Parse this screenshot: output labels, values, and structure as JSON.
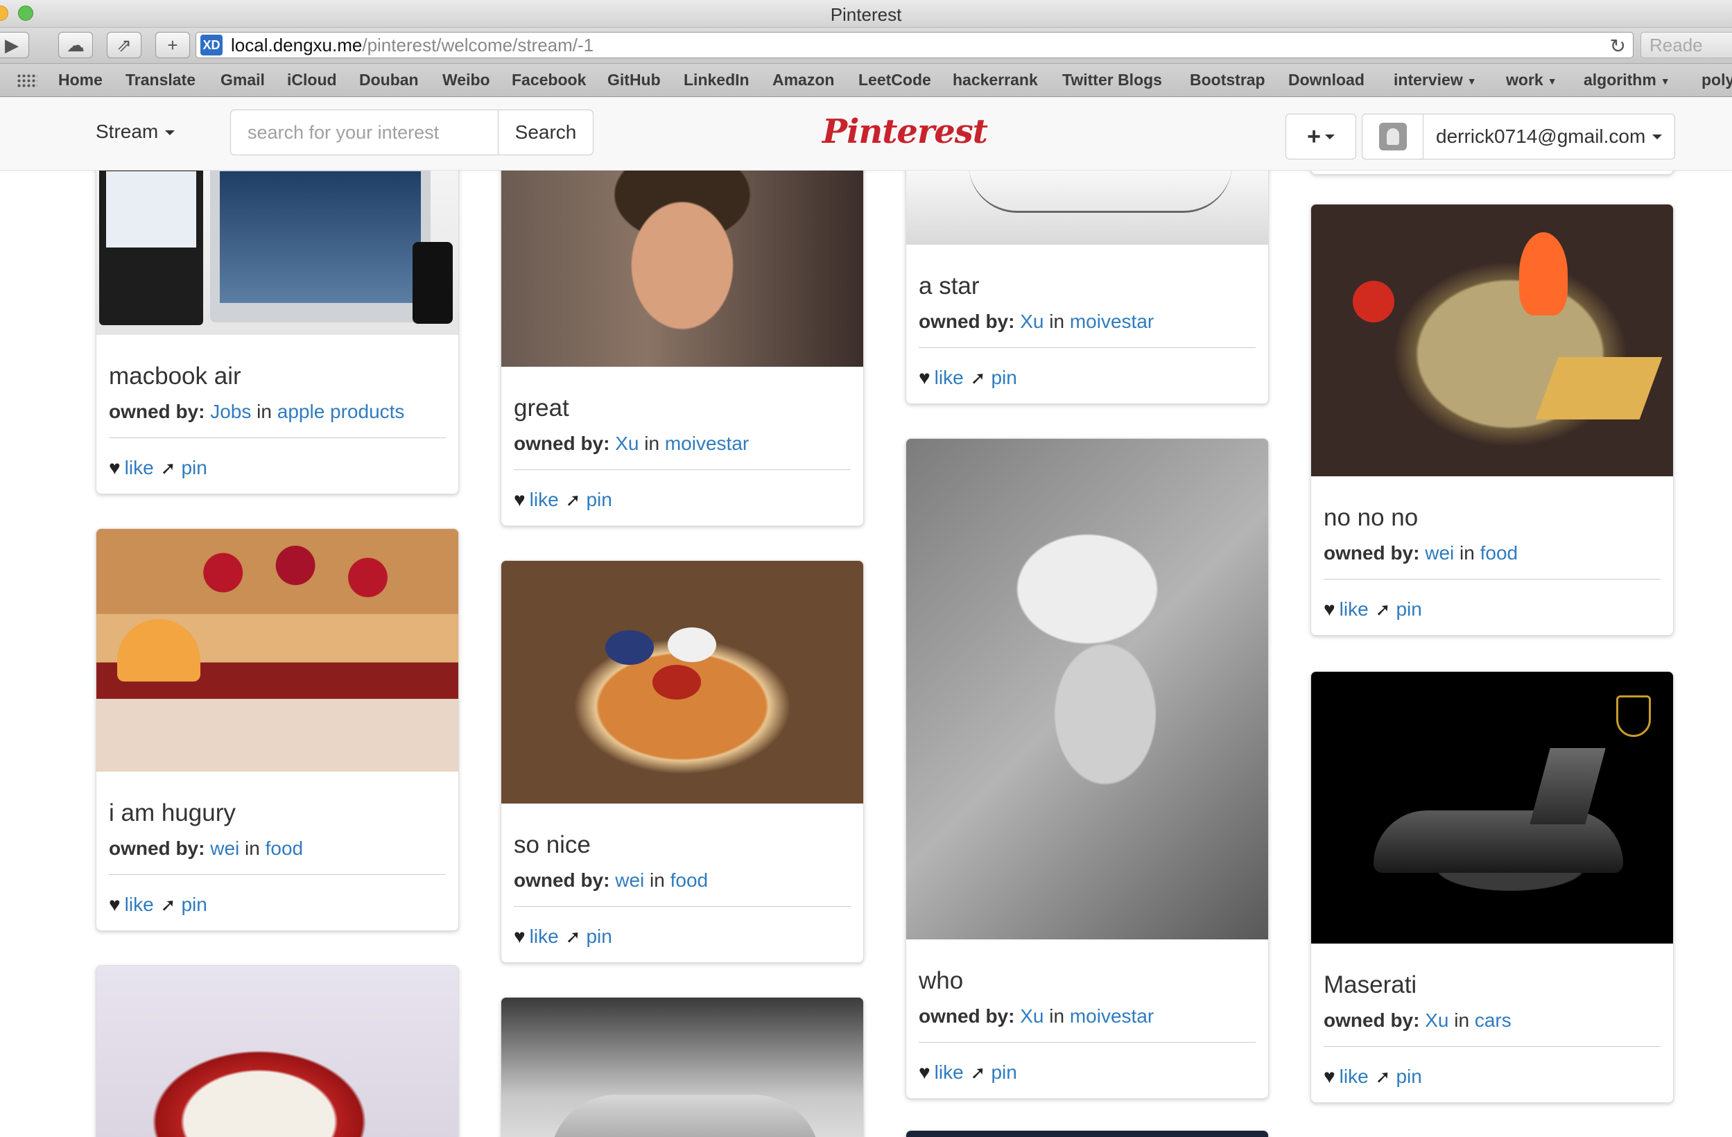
{
  "window": {
    "title": "Pinterest"
  },
  "browser": {
    "url_host": "local.dengxu.me",
    "url_path": "/pinterest/welcome/stream/-1",
    "reader_label": "Reade",
    "favicon_text": "XD"
  },
  "bookmarks": [
    {
      "label": "Home"
    },
    {
      "label": "Translate"
    },
    {
      "label": "Gmail"
    },
    {
      "label": "iCloud"
    },
    {
      "label": "Douban"
    },
    {
      "label": "Weibo"
    },
    {
      "label": "Facebook"
    },
    {
      "label": "GitHub"
    },
    {
      "label": "LinkedIn"
    },
    {
      "label": "Amazon"
    },
    {
      "label": "LeetCode"
    },
    {
      "label": "hackerrank"
    },
    {
      "label": "Twitter Blogs"
    },
    {
      "label": "Bootstrap"
    },
    {
      "label": "Download"
    },
    {
      "label": "interview"
    },
    {
      "label": "work"
    },
    {
      "label": "algorithm"
    },
    {
      "label": "poly"
    }
  ],
  "navbar": {
    "stream_label": "Stream",
    "search_placeholder": "search for your interest",
    "search_button": "Search",
    "logo": "Pinterest",
    "add_icon": "+",
    "user_email": "derrick0714@gmail.com"
  },
  "pin_labels": {
    "owned_by": "owned by:",
    "in": "in",
    "like": "like",
    "pin": "pin"
  },
  "pins": [
    {
      "title": "macbook air",
      "owner": "Jobs",
      "board": "apple products",
      "image": "macbook-image"
    },
    {
      "title": "i am hugury",
      "owner": "wei",
      "board": "food",
      "image": "french-toast-image"
    },
    {
      "title": "great",
      "owner": "Xu",
      "board": "moivestar",
      "image": "actor-portrait-image"
    },
    {
      "title": "so nice",
      "owner": "wei",
      "board": "food",
      "image": "appetizer-platter-image"
    },
    {
      "title": "a star",
      "owner": "Xu",
      "board": "moivestar",
      "image": "sketch-image"
    },
    {
      "title": "who",
      "owner": "Xu",
      "board": "moivestar",
      "image": "actress-portrait-image"
    },
    {
      "title": "no no no",
      "owner": "wei",
      "board": "food",
      "image": "salad-plate-image"
    },
    {
      "title": "Maserati",
      "owner": "Xu",
      "board": "cars",
      "image": "sports-car-image"
    }
  ],
  "colors": {
    "brand_red": "#c8232c",
    "link_blue": "#2f7bbf"
  }
}
